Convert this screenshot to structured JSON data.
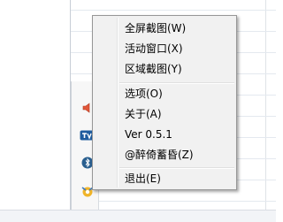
{
  "menu": {
    "items": [
      {
        "label": "全屏截图(W)"
      },
      {
        "label": "活动窗口(X)"
      },
      {
        "label": "区域截图(Y)"
      },
      {
        "label": "选项(O)"
      },
      {
        "label": "关于(A)"
      },
      {
        "label": "Ver 0.5.1"
      },
      {
        "label": "@醉倚蓄昏(Z)"
      },
      {
        "label": "退出(E)"
      }
    ]
  },
  "tray": {
    "icons": [
      "speaker-icon",
      "teamviewer-icon",
      "bluetooth-icon",
      "settings-app-icon"
    ]
  },
  "colors": {
    "menu_bg": "#f1f1f1",
    "menu_border": "#979797",
    "row_line": "#e4e9ef"
  }
}
